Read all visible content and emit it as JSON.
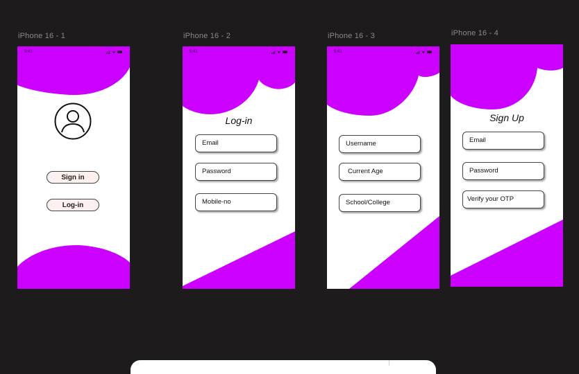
{
  "colors": {
    "canvas": "#1d1b1c",
    "accent": "#cc00ff",
    "label": "#8b8b8b"
  },
  "frames": [
    {
      "label": "iPhone 16 - 1",
      "time": "9:41",
      "buttons": [
        "Sign in",
        "Log-in"
      ],
      "icon": "user-avatar-icon"
    },
    {
      "label": "iPhone 16 - 2",
      "time": "9:41",
      "title": "Log-in",
      "fields": [
        "Email",
        "Password",
        "Mobile-no"
      ]
    },
    {
      "label": "iPhone 16 - 3",
      "time": "9:41",
      "fields": [
        "Username",
        "Current Age",
        "School/College"
      ]
    },
    {
      "label": "iPhone 16 - 4",
      "title": "Sign Up",
      "fields": [
        "Email",
        "Password",
        "Verify your OTP"
      ]
    }
  ]
}
